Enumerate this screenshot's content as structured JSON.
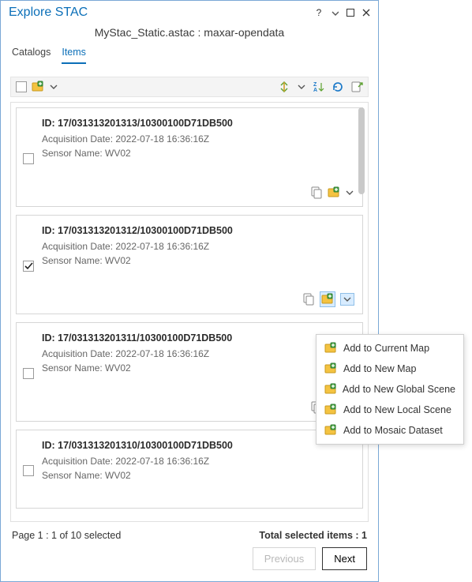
{
  "header": {
    "title": "Explore STAC",
    "subtitle": "MyStac_Static.astac : maxar-opendata"
  },
  "tabs": {
    "catalogs": "Catalogs",
    "items": "Items"
  },
  "items": [
    {
      "id": "ID: 17/031313201313/10300100D71DB500",
      "acq": "Acquisition Date: 2022-07-18 16:36:16Z",
      "sensor": "Sensor Name: WV02",
      "checked": false
    },
    {
      "id": "ID: 17/031313201312/10300100D71DB500",
      "acq": "Acquisition Date: 2022-07-18 16:36:16Z",
      "sensor": "Sensor Name: WV02",
      "checked": true
    },
    {
      "id": "ID: 17/031313201311/10300100D71DB500",
      "acq": "Acquisition Date: 2022-07-18 16:36:16Z",
      "sensor": "Sensor Name: WV02",
      "checked": false
    },
    {
      "id": "ID: 17/031313201310/10300100D71DB500",
      "acq": "Acquisition Date: 2022-07-18 16:36:16Z",
      "sensor": "Sensor Name: WV02",
      "checked": false
    }
  ],
  "menu": {
    "currentMap": "Add to Current  Map",
    "newMap": "Add to New Map",
    "newGlobal": "Add to New Global Scene",
    "newLocal": "Add to New Local Scene",
    "mosaic": "Add to Mosaic Dataset"
  },
  "status": {
    "page": "Page 1 : 1 of 10 selected",
    "total": "Total selected items : 1"
  },
  "buttons": {
    "prev": "Previous",
    "next": "Next"
  }
}
